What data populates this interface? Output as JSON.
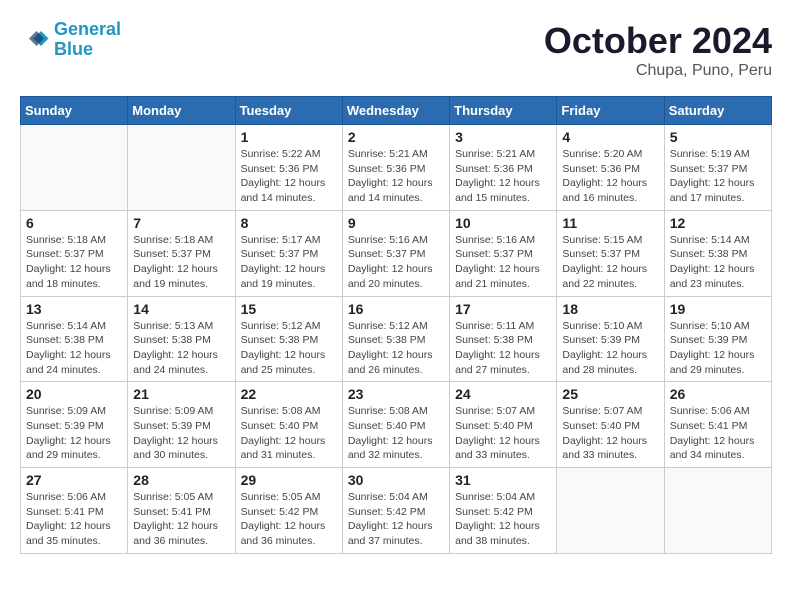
{
  "header": {
    "logo_line1": "General",
    "logo_line2": "Blue",
    "month": "October 2024",
    "location": "Chupa, Puno, Peru"
  },
  "columns": [
    "Sunday",
    "Monday",
    "Tuesday",
    "Wednesday",
    "Thursday",
    "Friday",
    "Saturday"
  ],
  "weeks": [
    [
      {
        "day": "",
        "detail": ""
      },
      {
        "day": "",
        "detail": ""
      },
      {
        "day": "1",
        "detail": "Sunrise: 5:22 AM\nSunset: 5:36 PM\nDaylight: 12 hours\nand 14 minutes."
      },
      {
        "day": "2",
        "detail": "Sunrise: 5:21 AM\nSunset: 5:36 PM\nDaylight: 12 hours\nand 14 minutes."
      },
      {
        "day": "3",
        "detail": "Sunrise: 5:21 AM\nSunset: 5:36 PM\nDaylight: 12 hours\nand 15 minutes."
      },
      {
        "day": "4",
        "detail": "Sunrise: 5:20 AM\nSunset: 5:36 PM\nDaylight: 12 hours\nand 16 minutes."
      },
      {
        "day": "5",
        "detail": "Sunrise: 5:19 AM\nSunset: 5:37 PM\nDaylight: 12 hours\nand 17 minutes."
      }
    ],
    [
      {
        "day": "6",
        "detail": "Sunrise: 5:18 AM\nSunset: 5:37 PM\nDaylight: 12 hours\nand 18 minutes."
      },
      {
        "day": "7",
        "detail": "Sunrise: 5:18 AM\nSunset: 5:37 PM\nDaylight: 12 hours\nand 19 minutes."
      },
      {
        "day": "8",
        "detail": "Sunrise: 5:17 AM\nSunset: 5:37 PM\nDaylight: 12 hours\nand 19 minutes."
      },
      {
        "day": "9",
        "detail": "Sunrise: 5:16 AM\nSunset: 5:37 PM\nDaylight: 12 hours\nand 20 minutes."
      },
      {
        "day": "10",
        "detail": "Sunrise: 5:16 AM\nSunset: 5:37 PM\nDaylight: 12 hours\nand 21 minutes."
      },
      {
        "day": "11",
        "detail": "Sunrise: 5:15 AM\nSunset: 5:37 PM\nDaylight: 12 hours\nand 22 minutes."
      },
      {
        "day": "12",
        "detail": "Sunrise: 5:14 AM\nSunset: 5:38 PM\nDaylight: 12 hours\nand 23 minutes."
      }
    ],
    [
      {
        "day": "13",
        "detail": "Sunrise: 5:14 AM\nSunset: 5:38 PM\nDaylight: 12 hours\nand 24 minutes."
      },
      {
        "day": "14",
        "detail": "Sunrise: 5:13 AM\nSunset: 5:38 PM\nDaylight: 12 hours\nand 24 minutes."
      },
      {
        "day": "15",
        "detail": "Sunrise: 5:12 AM\nSunset: 5:38 PM\nDaylight: 12 hours\nand 25 minutes."
      },
      {
        "day": "16",
        "detail": "Sunrise: 5:12 AM\nSunset: 5:38 PM\nDaylight: 12 hours\nand 26 minutes."
      },
      {
        "day": "17",
        "detail": "Sunrise: 5:11 AM\nSunset: 5:38 PM\nDaylight: 12 hours\nand 27 minutes."
      },
      {
        "day": "18",
        "detail": "Sunrise: 5:10 AM\nSunset: 5:39 PM\nDaylight: 12 hours\nand 28 minutes."
      },
      {
        "day": "19",
        "detail": "Sunrise: 5:10 AM\nSunset: 5:39 PM\nDaylight: 12 hours\nand 29 minutes."
      }
    ],
    [
      {
        "day": "20",
        "detail": "Sunrise: 5:09 AM\nSunset: 5:39 PM\nDaylight: 12 hours\nand 29 minutes."
      },
      {
        "day": "21",
        "detail": "Sunrise: 5:09 AM\nSunset: 5:39 PM\nDaylight: 12 hours\nand 30 minutes."
      },
      {
        "day": "22",
        "detail": "Sunrise: 5:08 AM\nSunset: 5:40 PM\nDaylight: 12 hours\nand 31 minutes."
      },
      {
        "day": "23",
        "detail": "Sunrise: 5:08 AM\nSunset: 5:40 PM\nDaylight: 12 hours\nand 32 minutes."
      },
      {
        "day": "24",
        "detail": "Sunrise: 5:07 AM\nSunset: 5:40 PM\nDaylight: 12 hours\nand 33 minutes."
      },
      {
        "day": "25",
        "detail": "Sunrise: 5:07 AM\nSunset: 5:40 PM\nDaylight: 12 hours\nand 33 minutes."
      },
      {
        "day": "26",
        "detail": "Sunrise: 5:06 AM\nSunset: 5:41 PM\nDaylight: 12 hours\nand 34 minutes."
      }
    ],
    [
      {
        "day": "27",
        "detail": "Sunrise: 5:06 AM\nSunset: 5:41 PM\nDaylight: 12 hours\nand 35 minutes."
      },
      {
        "day": "28",
        "detail": "Sunrise: 5:05 AM\nSunset: 5:41 PM\nDaylight: 12 hours\nand 36 minutes."
      },
      {
        "day": "29",
        "detail": "Sunrise: 5:05 AM\nSunset: 5:42 PM\nDaylight: 12 hours\nand 36 minutes."
      },
      {
        "day": "30",
        "detail": "Sunrise: 5:04 AM\nSunset: 5:42 PM\nDaylight: 12 hours\nand 37 minutes."
      },
      {
        "day": "31",
        "detail": "Sunrise: 5:04 AM\nSunset: 5:42 PM\nDaylight: 12 hours\nand 38 minutes."
      },
      {
        "day": "",
        "detail": ""
      },
      {
        "day": "",
        "detail": ""
      }
    ]
  ]
}
